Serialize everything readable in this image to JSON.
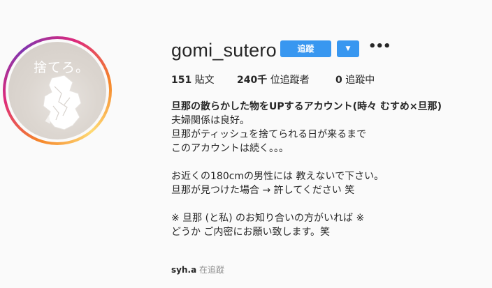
{
  "profile": {
    "avatar_text": "捨てろ。",
    "username": "gomi_sutero",
    "follow_label": "追蹤",
    "dropdown_icon": "▼",
    "more_icon": "•••"
  },
  "stats": {
    "posts_count": "151",
    "posts_label": "貼文",
    "followers_count": "240千",
    "followers_label": "位追蹤者",
    "following_count": "0",
    "following_label": "追蹤中"
  },
  "bio": {
    "name": "旦那の散らかした物をUPするアカウント(時々 むすめ×旦那)",
    "lines": [
      "夫婦関係は良好。",
      "旦那がティッシュを捨てられる日が来るまで",
      "このアカウントは続く。。。",
      "",
      "お近くの180cmの男性には 教えないで下さい。",
      "旦那が見つけた場合 → 許してください 笑",
      "",
      "※ 旦那 (と私) のお知り合いの方がいれば ※",
      "どうか ご内密にお願い致します。笑"
    ]
  },
  "followed_by": {
    "user": "syh.a",
    "label": "在追蹤"
  },
  "colors": {
    "accent": "#3897f0",
    "text": "#262626",
    "muted": "#8e8e8e",
    "background": "#fafafa"
  }
}
